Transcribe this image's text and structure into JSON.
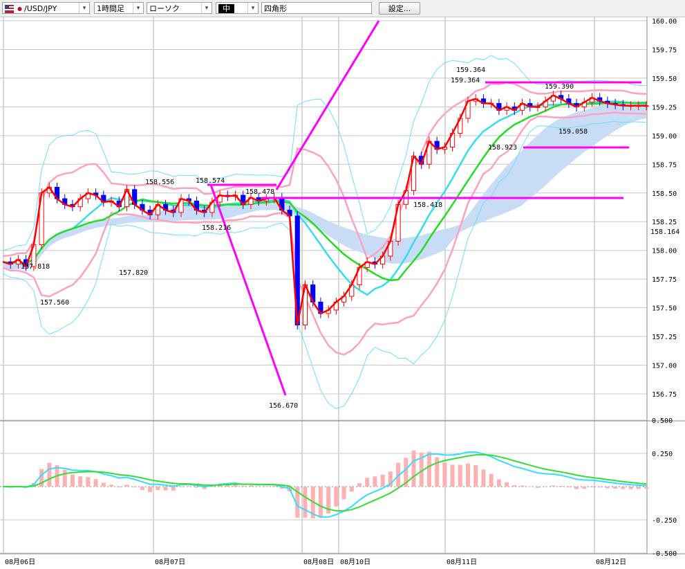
{
  "toolbar": {
    "symbol": "USD/JPY",
    "symbol_prefix": "/",
    "timeframe": "1時間足",
    "chart_type": "ローソク",
    "line_width": "中",
    "draw_tool": "四角形",
    "settings_label": "設定..."
  },
  "colors": {
    "price_line": "#ff0000",
    "bb_outer": "#66e0ff",
    "bb_inner": "#ffa0c0",
    "ma": "#00dd00",
    "ma_center": "#00dddd",
    "cloud": "#c8dcf5",
    "trend": "#ff00ff",
    "candle_up": "#ff0000",
    "candle_down": "#0000ff",
    "macd_line": "#33ddff",
    "signal_line": "#33dd33",
    "histogram": "#ffb0b0"
  },
  "chart_data": {
    "type": "candlestick",
    "price_axis": {
      "ticks": [
        "160.00",
        "159.75",
        "159.50",
        "159.25",
        "159.00",
        "158.75",
        "158.50",
        "158.25",
        "158.00",
        "157.75",
        "157.50",
        "157.25",
        "157.00",
        "156.75"
      ],
      "ylim": [
        156.75,
        160.0
      ],
      "current_price": "158.164"
    },
    "macd_axis": {
      "ticks": [
        "0.500",
        "0.250",
        "-0.250",
        "-0.500"
      ],
      "ylim": [
        -0.5,
        0.5
      ]
    },
    "x_labels": [
      "08月06日",
      "08月07日",
      "08月08日",
      "08月10日",
      "08月11日",
      "08月12日"
    ],
    "price_annotations": [
      "157.818",
      "157.560",
      "157.820",
      "158.556",
      "158.574",
      "158.216",
      "158.478",
      "156.670",
      "158.418",
      "159.364",
      "159.364",
      "158.923",
      "159.390",
      "159.058"
    ],
    "price_line": [
      157.9,
      157.88,
      157.92,
      157.86,
      158.05,
      158.5,
      158.55,
      158.45,
      158.4,
      158.38,
      158.45,
      158.5,
      158.48,
      158.42,
      158.43,
      158.38,
      158.53,
      158.4,
      158.35,
      158.31,
      158.4,
      158.35,
      158.33,
      158.45,
      158.43,
      158.35,
      158.33,
      158.42,
      158.48,
      158.47,
      158.48,
      158.4,
      158.46,
      158.43,
      158.45,
      158.46,
      158.35,
      158.3,
      157.35,
      157.7,
      157.55,
      157.45,
      157.48,
      157.55,
      157.6,
      157.7,
      157.85,
      157.9,
      157.88,
      157.95,
      158.08,
      158.4,
      158.52,
      158.82,
      158.75,
      158.95,
      158.88,
      158.9,
      159.02,
      159.15,
      159.3,
      159.32,
      159.28,
      159.28,
      159.22,
      159.25,
      159.22,
      159.28,
      159.25,
      159.25,
      159.3,
      159.35,
      159.32,
      159.28,
      159.25,
      159.29,
      159.33,
      159.3,
      159.28,
      159.27,
      159.26,
      159.26,
      159.26,
      159.26
    ]
  }
}
